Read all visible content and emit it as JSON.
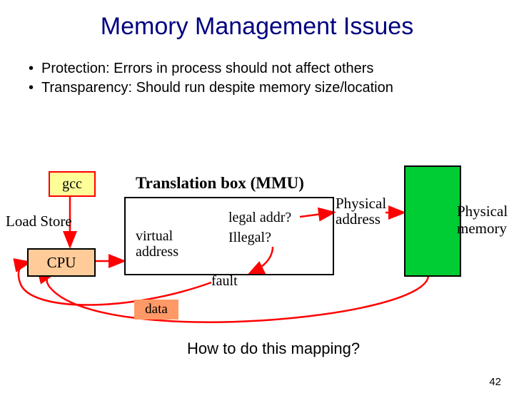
{
  "title": "Memory Management Issues",
  "bullets": {
    "b1": "Protection: Errors in process should not affect others",
    "b2": "Transparency: Should run despite memory size/location"
  },
  "diagram": {
    "gcc": "gcc",
    "loadstore": "Load  Store",
    "cpu": "CPU",
    "mmu_title": "Translation box (MMU)",
    "virtual_address_l1": "virtual",
    "virtual_address_l2": "address",
    "legal": "legal addr?",
    "illegal": "Illegal?",
    "physical_address_l1": "Physical",
    "physical_address_l2": "address",
    "pmem_l1": "Physical",
    "pmem_l2": "memory",
    "fault": "fault",
    "data": "data"
  },
  "question": "How to do this mapping?",
  "page_number": "42",
  "colors": {
    "title": "#000080",
    "gcc_fill": "#ffff99",
    "gcc_border": "#ff0000",
    "cpu_fill": "#ffcc99",
    "pmem_fill": "#00cc33",
    "data_fill": "#ff9966",
    "arrow_red": "#ff0000"
  }
}
